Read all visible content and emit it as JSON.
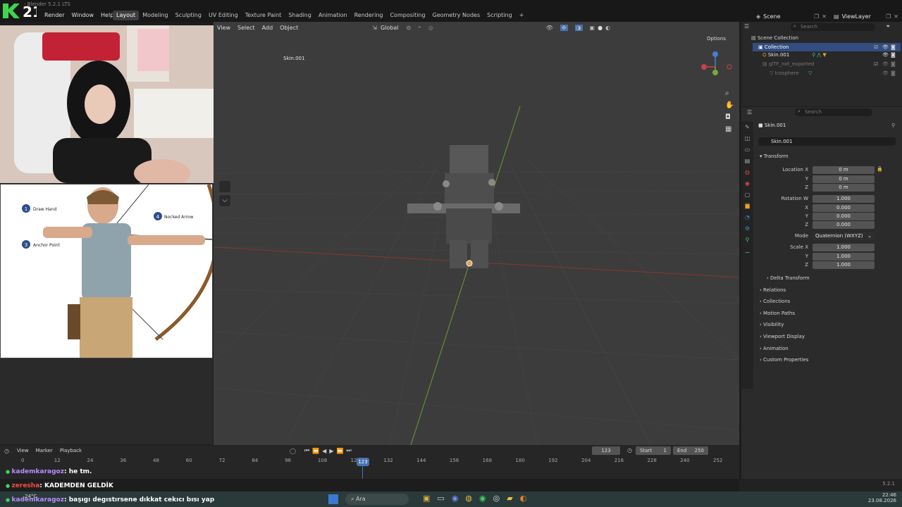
{
  "app": {
    "title": "- Blender 5.2.1 LTS",
    "logo_text": "21",
    "menus": [
      "Render",
      "Window",
      "Help"
    ],
    "tabs": [
      "Layout",
      "Modeling",
      "Sculpting",
      "UV Editing",
      "Texture Paint",
      "Shading",
      "Animation",
      "Rendering",
      "Compositing",
      "Geometry Nodes",
      "Scripting"
    ],
    "active_tab": "Layout",
    "add_tab": "+",
    "scene": "Scene",
    "view_layer": "ViewLayer"
  },
  "viewport": {
    "menus": [
      "View",
      "Select",
      "Add",
      "Object"
    ],
    "orientation": "Global",
    "options": "Options",
    "object_label": "Skin.001"
  },
  "outliner": {
    "search_placeholder": "Search",
    "items": [
      {
        "label": "Scene Collection"
      },
      {
        "label": "Collection"
      },
      {
        "label": "Skin.001"
      },
      {
        "label": "glTF_not_exported"
      },
      {
        "label": "Icosphere"
      }
    ]
  },
  "properties": {
    "search_placeholder": "Search",
    "object_name": "Skin.001",
    "data_name": "Skin.001",
    "transform_header": "Transform",
    "location_label": "Location X",
    "y_label": "Y",
    "z_label": "Z",
    "x_label": "X",
    "location": [
      "0 m",
      "0 m",
      "0 m"
    ],
    "rotation_label": "Rotation W",
    "rotation": [
      "1.000",
      "0.000",
      "0.000",
      "0.000"
    ],
    "mode_label": "Mode",
    "mode_value": "Quaternion (WXYZ)",
    "scale_label": "Scale X",
    "scale": [
      "1.000",
      "1.000",
      "1.000"
    ],
    "delta_transform": "Delta Transform",
    "sections": [
      "Relations",
      "Collections",
      "Motion Paths",
      "Visibility",
      "Viewport Display",
      "Animation",
      "Custom Properties"
    ]
  },
  "timeline": {
    "menus": [
      "View",
      "Marker",
      "Playback"
    ],
    "current_frame": "123",
    "start_label": "Start",
    "start": "1",
    "end_label": "End",
    "end": "250",
    "ticks": [
      "0",
      "12",
      "24",
      "36",
      "48",
      "60",
      "72",
      "84",
      "96",
      "108",
      "120",
      "132",
      "144",
      "156",
      "168",
      "180",
      "192",
      "204",
      "216",
      "228",
      "240",
      "252"
    ],
    "playhead": "123"
  },
  "chat": [
    {
      "user": "kademkaragoz",
      "text": ": he tm.",
      "color": "#b98cff"
    },
    {
      "user": "zeresha",
      "text": ": KADEMDEN GELDİK",
      "color": "#ff4a4a"
    },
    {
      "user": "kademkaragoz",
      "text": ": başıgı degıstırsene dıkkat cekıcı bısı yap",
      "color": "#b98cff"
    }
  ],
  "reference": {
    "labels": [
      "Draw Hand",
      "Nocked Arrow",
      "Anchor Point"
    ],
    "numbers": [
      "1",
      "4",
      "3"
    ]
  },
  "taskbar": {
    "weather": "24°C",
    "search": "Ara",
    "time": "22:46",
    "date": "23.08.2026"
  },
  "status": {
    "version": "5.2.1"
  },
  "colors": {
    "accent": "#4772b3",
    "active_object": "#f0a020",
    "green_axis": "#7aa83a",
    "red_axis": "#a63a3a"
  }
}
